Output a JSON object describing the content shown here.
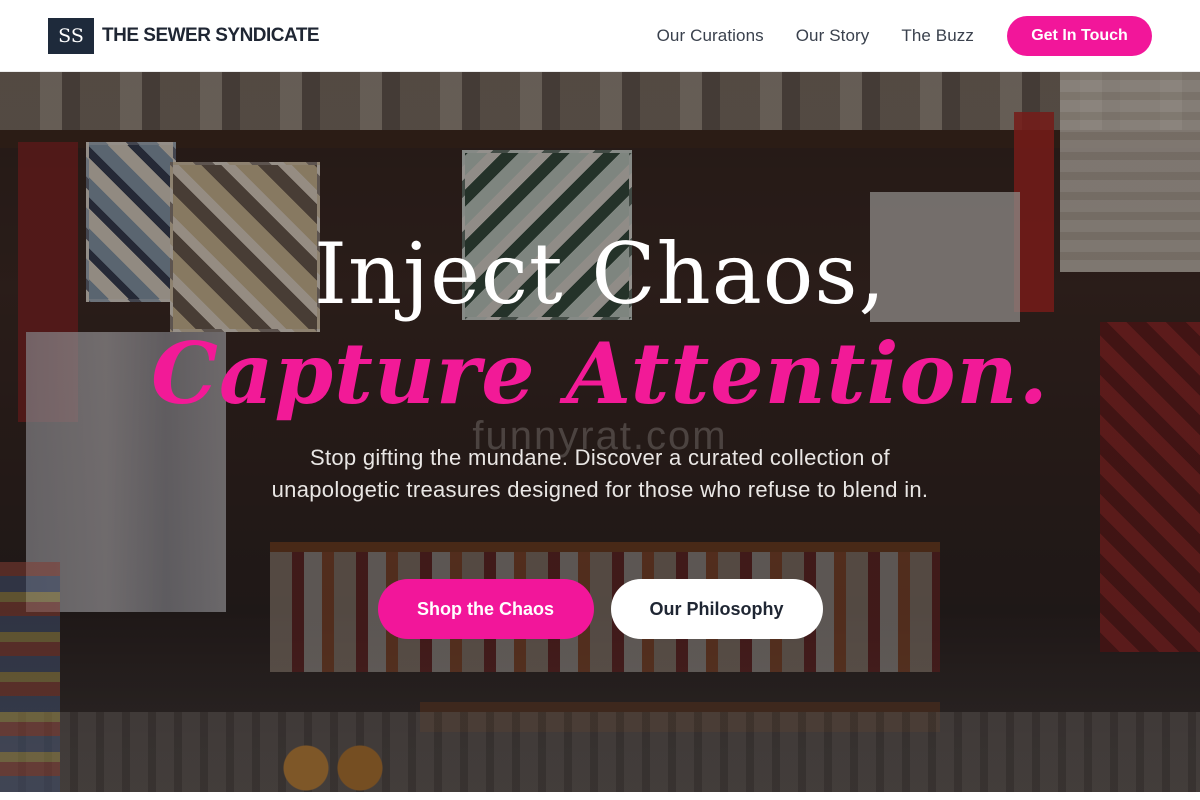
{
  "header": {
    "logo_mark": "SS",
    "brand_name": "THE SEWER SYNDICATE",
    "nav": [
      {
        "label": "Our Curations"
      },
      {
        "label": "Our Story"
      },
      {
        "label": "The Buzz"
      }
    ],
    "cta_label": "Get In Touch"
  },
  "hero": {
    "headline_line1": "Inject Chaos,",
    "headline_line2": "Capture Attention.",
    "subtext": "Stop gifting the mundane. Discover a curated collection of unapologetic treasures designed for those who refuse to blend in.",
    "watermark": "funnyrat.com",
    "primary_button": "Shop the Chaos",
    "secondary_button": "Our Philosophy",
    "background_image": "market-stall-photo"
  },
  "colors": {
    "accent": "#f2169a",
    "logo_bg": "#1e2a3b",
    "text_dark": "#1f2633"
  }
}
